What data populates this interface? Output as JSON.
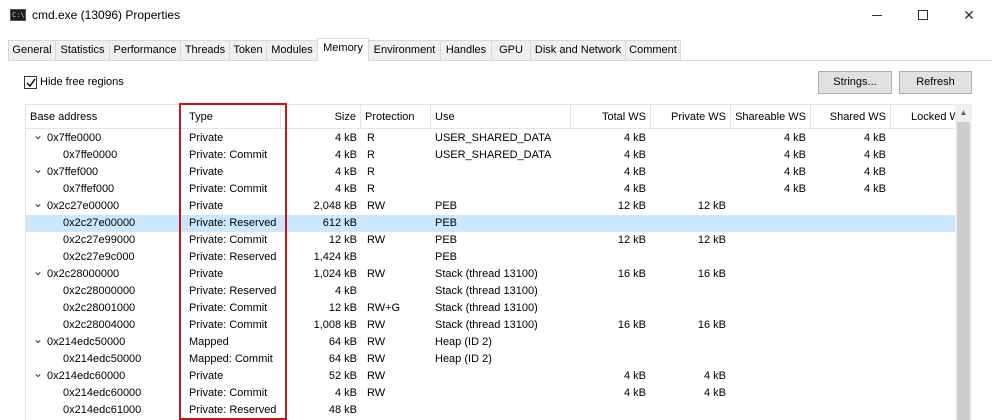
{
  "window": {
    "title": "cmd.exe (13096) Properties",
    "icon_text": "C:\\",
    "min_icon": "minimize-icon",
    "max_icon": "maximize-icon",
    "close_glyph": "✕"
  },
  "tabs": [
    {
      "label": "General"
    },
    {
      "label": "Statistics"
    },
    {
      "label": "Performance"
    },
    {
      "label": "Threads"
    },
    {
      "label": "Token"
    },
    {
      "label": "Modules"
    },
    {
      "label": "Memory",
      "active": true
    },
    {
      "label": "Environment"
    },
    {
      "label": "Handles"
    },
    {
      "label": "GPU"
    },
    {
      "label": "Disk and Network"
    },
    {
      "label": "Comment"
    }
  ],
  "toolbar": {
    "hide_free_regions": {
      "label": "Hide free regions",
      "checked": true
    },
    "strings_label": "Strings...",
    "refresh_label": "Refresh"
  },
  "columns": {
    "base_address": "Base address",
    "type": "Type",
    "size": "Size",
    "protection": "Protection",
    "use": "Use",
    "total_ws": "Total WS",
    "private_ws": "Private WS",
    "shareable_ws": "Shareable WS",
    "shared_ws": "Shared WS",
    "locked_ws": "Locked W"
  },
  "rows": [
    {
      "level": 0,
      "expanded": true,
      "base": "0x7ffe0000",
      "type": "Private",
      "size": "4 kB",
      "prot": "R",
      "use": "USER_SHARED_DATA",
      "total_ws": "4 kB",
      "private_ws": "",
      "shareable_ws": "4 kB",
      "shared_ws": "4 kB"
    },
    {
      "level": 1,
      "base": "0x7ffe0000",
      "type": "Private: Commit",
      "size": "4 kB",
      "prot": "R",
      "use": "USER_SHARED_DATA",
      "total_ws": "4 kB",
      "private_ws": "",
      "shareable_ws": "4 kB",
      "shared_ws": "4 kB"
    },
    {
      "level": 0,
      "expanded": true,
      "base": "0x7ffef000",
      "type": "Private",
      "size": "4 kB",
      "prot": "R",
      "use": "",
      "total_ws": "4 kB",
      "private_ws": "",
      "shareable_ws": "4 kB",
      "shared_ws": "4 kB"
    },
    {
      "level": 1,
      "base": "0x7ffef000",
      "type": "Private: Commit",
      "size": "4 kB",
      "prot": "R",
      "use": "",
      "total_ws": "4 kB",
      "private_ws": "",
      "shareable_ws": "4 kB",
      "shared_ws": "4 kB"
    },
    {
      "level": 0,
      "expanded": true,
      "base": "0x2c27e00000",
      "type": "Private",
      "size": "2,048 kB",
      "prot": "RW",
      "use": "PEB",
      "total_ws": "12 kB",
      "private_ws": "12 kB",
      "shareable_ws": "",
      "shared_ws": ""
    },
    {
      "level": 1,
      "selected": true,
      "base": "0x2c27e00000",
      "type": "Private: Reserved",
      "size": "612 kB",
      "prot": "",
      "use": "PEB",
      "total_ws": "",
      "private_ws": "",
      "shareable_ws": "",
      "shared_ws": ""
    },
    {
      "level": 1,
      "base": "0x2c27e99000",
      "type": "Private: Commit",
      "size": "12 kB",
      "prot": "RW",
      "use": "PEB",
      "total_ws": "12 kB",
      "private_ws": "12 kB",
      "shareable_ws": "",
      "shared_ws": ""
    },
    {
      "level": 1,
      "base": "0x2c27e9c000",
      "type": "Private: Reserved",
      "size": "1,424 kB",
      "prot": "",
      "use": "PEB",
      "total_ws": "",
      "private_ws": "",
      "shareable_ws": "",
      "shared_ws": ""
    },
    {
      "level": 0,
      "expanded": true,
      "base": "0x2c28000000",
      "type": "Private",
      "size": "1,024 kB",
      "prot": "RW",
      "use": "Stack (thread 13100)",
      "total_ws": "16 kB",
      "private_ws": "16 kB",
      "shareable_ws": "",
      "shared_ws": ""
    },
    {
      "level": 1,
      "base": "0x2c28000000",
      "type": "Private: Reserved",
      "size": "4 kB",
      "prot": "",
      "use": "Stack (thread 13100)",
      "total_ws": "",
      "private_ws": "",
      "shareable_ws": "",
      "shared_ws": ""
    },
    {
      "level": 1,
      "base": "0x2c28001000",
      "type": "Private: Commit",
      "size": "12 kB",
      "prot": "RW+G",
      "use": "Stack (thread 13100)",
      "total_ws": "",
      "private_ws": "",
      "shareable_ws": "",
      "shared_ws": ""
    },
    {
      "level": 1,
      "base": "0x2c28004000",
      "type": "Private: Commit",
      "size": "1,008 kB",
      "prot": "RW",
      "use": "Stack (thread 13100)",
      "total_ws": "16 kB",
      "private_ws": "16 kB",
      "shareable_ws": "",
      "shared_ws": ""
    },
    {
      "level": 0,
      "expanded": true,
      "base": "0x214edc50000",
      "type": "Mapped",
      "size": "64 kB",
      "prot": "RW",
      "use": "Heap (ID 2)",
      "total_ws": "",
      "private_ws": "",
      "shareable_ws": "",
      "shared_ws": ""
    },
    {
      "level": 1,
      "base": "0x214edc50000",
      "type": "Mapped: Commit",
      "size": "64 kB",
      "prot": "RW",
      "use": "Heap (ID 2)",
      "total_ws": "",
      "private_ws": "",
      "shareable_ws": "",
      "shared_ws": ""
    },
    {
      "level": 0,
      "expanded": true,
      "base": "0x214edc60000",
      "type": "Private",
      "size": "52 kB",
      "prot": "RW",
      "use": "",
      "total_ws": "4 kB",
      "private_ws": "4 kB",
      "shareable_ws": "",
      "shared_ws": ""
    },
    {
      "level": 1,
      "base": "0x214edc60000",
      "type": "Private: Commit",
      "size": "4 kB",
      "prot": "RW",
      "use": "",
      "total_ws": "4 kB",
      "private_ws": "4 kB",
      "shareable_ws": "",
      "shared_ws": ""
    },
    {
      "level": 1,
      "base": "0x214edc61000",
      "type": "Private: Reserved",
      "size": "48 kB",
      "prot": "",
      "use": "",
      "total_ws": "",
      "private_ws": "",
      "shareable_ws": "",
      "shared_ws": ""
    }
  ],
  "colors": {
    "selection": "#cce8ff",
    "highlight_box": "#c4161c"
  },
  "icons": {
    "expand": "chevron-down-icon",
    "checkbox": "checkmark-icon",
    "scroll_up": "scroll-up-arrow-icon"
  }
}
